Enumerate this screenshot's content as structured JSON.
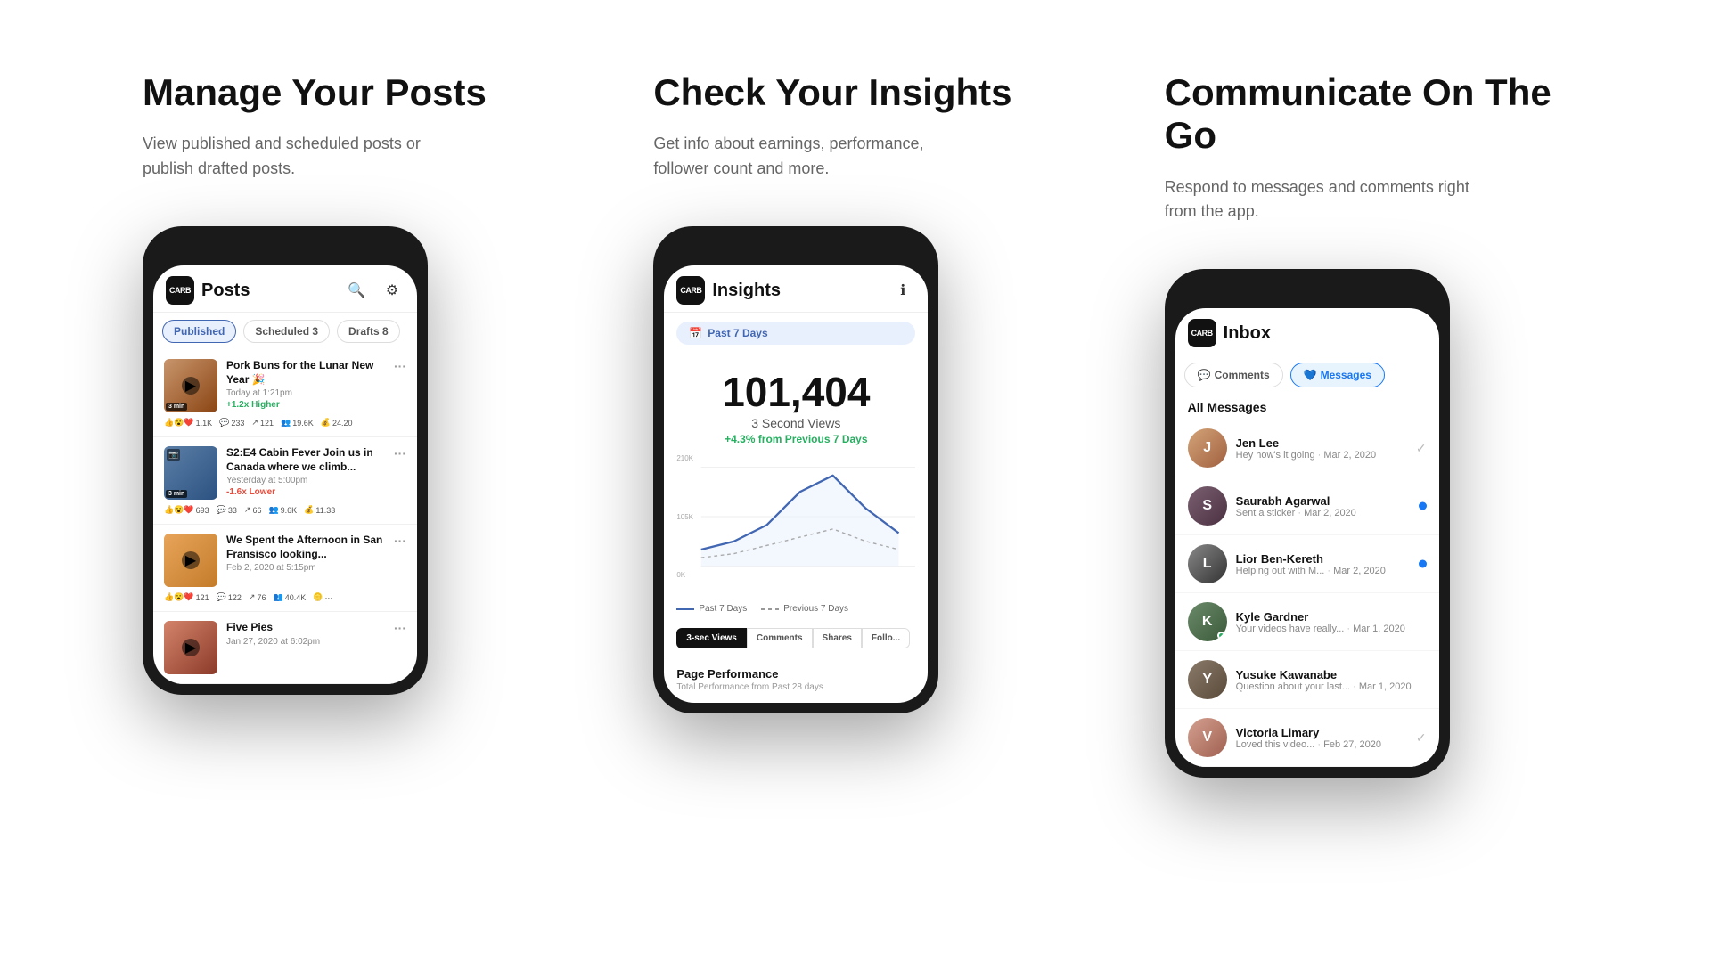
{
  "features": [
    {
      "id": "posts",
      "title": "Manage Your Posts",
      "description": "View published and scheduled posts or publish drafted posts.",
      "app": {
        "name": "Posts",
        "logo": "CARB",
        "tabs": [
          {
            "label": "Published",
            "active": true
          },
          {
            "label": "Scheduled 3",
            "active": false
          },
          {
            "label": "Drafts 8",
            "active": false
          }
        ],
        "posts": [
          {
            "title": "Pork Buns for the Lunar New Year 🎉",
            "date": "Today at 1:21pm",
            "perf": "+1.2x Higher",
            "perfDir": "up",
            "duration": "3 min",
            "thumbType": "pork",
            "stats": {
              "reactions": "1.1K",
              "comments": "233",
              "shares": "121",
              "reach": "19.6K",
              "earnings": "24.20"
            }
          },
          {
            "title": "S2:E4 Cabin Fever Join us in Canada where we climb...",
            "date": "Yesterday at 5:00pm",
            "perf": "-1.6x Lower",
            "perfDir": "down",
            "duration": "3 min",
            "thumbType": "cabin",
            "stats": {
              "reactions": "693",
              "comments": "33",
              "shares": "66",
              "reach": "9.6K",
              "earnings": "11.33"
            }
          },
          {
            "title": "We Spent the Afternoon in San Fransisco looking...",
            "date": "Feb 2, 2020 at 5:15pm",
            "perf": "",
            "perfDir": "",
            "duration": "",
            "thumbType": "sf",
            "stats": {
              "reactions": "121",
              "comments": "122",
              "shares": "76",
              "reach": "40.4K",
              "earnings": ""
            }
          },
          {
            "title": "Five Pies",
            "date": "Jan 27, 2020 at 6:02pm",
            "perf": "",
            "perfDir": "",
            "duration": "",
            "thumbType": "pies",
            "stats": {
              "reactions": "",
              "comments": "",
              "shares": "",
              "reach": "",
              "earnings": ""
            }
          }
        ]
      }
    },
    {
      "id": "insights",
      "title": "Check Your Insights",
      "description": "Get info about earnings, performance, follower count and more.",
      "app": {
        "name": "Insights",
        "logo": "CARB",
        "period": "Past 7 Days",
        "bigNumber": "101,404",
        "bigLabel": "3 Second Views",
        "bigChange": "+4.3% from Previous 7 Days",
        "yLabels": [
          "210K",
          "105K",
          "0K"
        ],
        "chartTabs": [
          {
            "label": "3-sec Views",
            "active": true
          },
          {
            "label": "Comments",
            "active": false
          },
          {
            "label": "Shares",
            "active": false
          },
          {
            "label": "Follo...",
            "active": false
          }
        ],
        "legend": [
          {
            "label": "Past 7 Days",
            "type": "solid"
          },
          {
            "label": "Previous 7 Days",
            "type": "dashed"
          }
        ],
        "pagePerf": {
          "title": "Page Performance",
          "sub": "Total Performance from Past 28 days"
        }
      }
    },
    {
      "id": "inbox",
      "title": "Communicate On The Go",
      "description": "Respond to messages and comments right from the app.",
      "app": {
        "name": "Inbox",
        "logo": "CARB",
        "tabs": [
          {
            "label": "Comments",
            "active": false,
            "icon": "💬"
          },
          {
            "label": "Messages",
            "active": true,
            "icon": "💙"
          }
        ],
        "allMessagesLabel": "All Messages",
        "messages": [
          {
            "name": "Jen Lee",
            "preview": "Hey how's it going",
            "time": "Mar 2, 2020",
            "avatarType": "jen",
            "status": "read",
            "online": false
          },
          {
            "name": "Saurabh Agarwal",
            "preview": "Sent a sticker",
            "time": "Mar 2, 2020",
            "avatarType": "saurabh",
            "status": "unread",
            "online": false
          },
          {
            "name": "Lior Ben-Kereth",
            "preview": "Helping out with M...",
            "time": "Mar 2, 2020",
            "avatarType": "lior",
            "status": "unread",
            "online": false
          },
          {
            "name": "Kyle Gardner",
            "preview": "Your videos have really...",
            "time": "Mar 1, 2020",
            "avatarType": "kyle",
            "status": "read",
            "online": true
          },
          {
            "name": "Yusuke Kawanabe",
            "preview": "Question about your last...",
            "time": "Mar 1, 2020",
            "avatarType": "yusuke",
            "status": "read",
            "online": false
          },
          {
            "name": "Victoria Limary",
            "preview": "Loved this video...",
            "time": "Feb 27, 2020",
            "avatarType": "victoria",
            "status": "read",
            "online": false
          }
        ]
      }
    }
  ]
}
